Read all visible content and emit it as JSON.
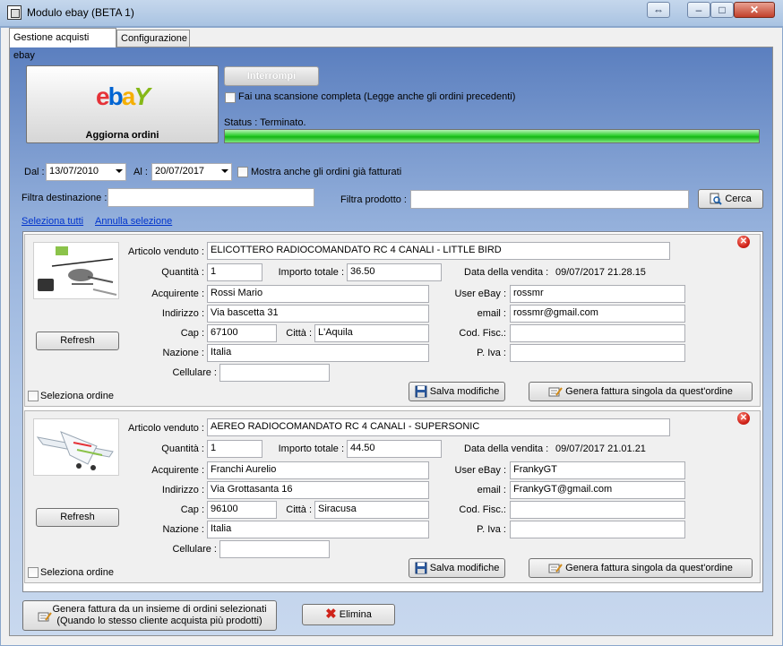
{
  "window": {
    "title": "Modulo ebay (BETA 1)",
    "restore_glyph": "⇔",
    "minimize_glyph": "–",
    "maximize_glyph": "□",
    "close_glyph": "✕"
  },
  "tabs": [
    {
      "label": "Gestione acquisti ebay",
      "active": true
    },
    {
      "label": "Configurazione",
      "active": false
    }
  ],
  "top": {
    "update_button_label": "Aggiorna ordini",
    "logo": {
      "e": "e",
      "b": "b",
      "a": "a",
      "y": "Y"
    },
    "stop_button_label": "Interrompi",
    "full_scan_label": "Fai una scansione completa (Legge anche gli ordini precedenti)",
    "status_text": "Status : Terminato.",
    "progress": 1.0
  },
  "filters": {
    "from_label": "Dal :",
    "from_value": "13/07/2010",
    "to_label": "Al :",
    "to_value": "20/07/2017",
    "show_invoiced_label": "Mostra anche gli ordini già fatturati",
    "destination_label": "Filtra destinazione :",
    "destination_value": "",
    "product_label": "Filtra prodotto :",
    "product_value": "",
    "search_button_label": "Cerca"
  },
  "selection": {
    "select_all": "Seleziona tutti",
    "deselect": "Annulla selezione"
  },
  "labels": {
    "article": "Articolo venduto :",
    "quantity": "Quantità :",
    "total": "Importo totale :",
    "sale_date": "Data della vendita :",
    "buyer": "Acquirente :",
    "ebay_user": "User eBay :",
    "address": "Indirizzo :",
    "email": "email :",
    "cap": "Cap :",
    "city": "Città :",
    "fiscal_code": "Cod. Fisc.:",
    "country": "Nazione :",
    "vat": "P. Iva :",
    "mobile": "Cellulare :",
    "refresh": "Refresh",
    "select_order": "Seleziona ordine",
    "save_changes": "Salva modifiche",
    "generate_single": "Genera fattura singola da quest'ordine"
  },
  "orders": [
    {
      "article": "ELICOTTERO RADIOCOMANDATO RC 4 CANALI - LITTLE BIRD",
      "quantity": "1",
      "total": "36.50",
      "sale_date": "09/07/2017 21.28.15",
      "buyer": "Rossi Mario",
      "ebay_user": "rossmr",
      "address": "Via bascetta 31",
      "email": "rossmr@gmail.com",
      "cap": "67100",
      "city": "L'Aquila",
      "fiscal_code": "",
      "country": "Italia",
      "vat": "",
      "mobile": ""
    },
    {
      "article": "AEREO RADIOCOMANDATO RC 4 CANALI - SUPERSONIC",
      "quantity": "1",
      "total": "44.50",
      "sale_date": "09/07/2017 21.01.21",
      "buyer": "Franchi Aurelio",
      "ebay_user": "FrankyGT",
      "address": "Via Grottasanta 16",
      "email": "FrankyGT@gmail.com",
      "cap": "96100",
      "city": "Siracusa",
      "fiscal_code": "",
      "country": "Italia",
      "vat": "",
      "mobile": ""
    }
  ],
  "bottom": {
    "multi_invoice_line1": "Genera fattura da un insieme di ordini selezionati",
    "multi_invoice_line2": "(Quando lo stesso cliente acquista più prodotti)",
    "delete_label": "Elimina"
  }
}
